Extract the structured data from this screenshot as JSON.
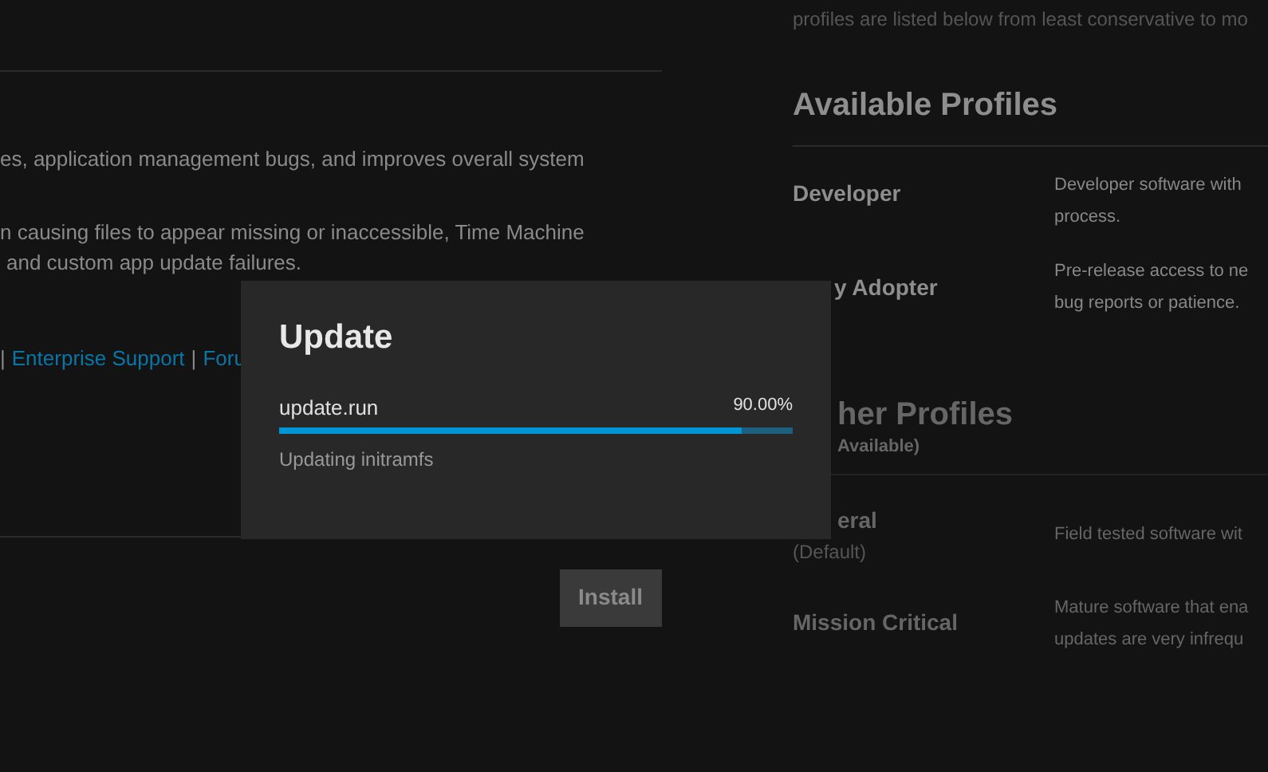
{
  "left": {
    "paragraphs": [
      "es, application management bugs, and improves overall system",
      "n causing files to appear missing or inaccessible, Time Machine",
      "and custom app update failures."
    ],
    "links": [
      {
        "kind": "sep",
        "text": "|"
      },
      {
        "kind": "link",
        "text": "Enterprise Support"
      },
      {
        "kind": "sep",
        "text": "|"
      },
      {
        "kind": "link",
        "text": "Foru"
      }
    ],
    "install_button": {
      "label": "Install",
      "disabled": true
    }
  },
  "right": {
    "intro": "profiles are listed below from least conservative to mo",
    "available": {
      "title": "Available Profiles",
      "profiles": [
        {
          "name": "Developer",
          "description": "Developer software with",
          "description_2": "process."
        },
        {
          "name": "y Adopter",
          "description": "Pre-release access to ne",
          "description_2": "bug reports or patience."
        }
      ]
    },
    "other": {
      "title": "her Profiles",
      "subtitle": "Available)",
      "profiles": [
        {
          "name": "eral",
          "note": "(Default)",
          "description": "Field tested software wit"
        },
        {
          "name": "Mission Critical",
          "description": "Mature software that ena",
          "description_2": "updates are very infrequ"
        }
      ]
    }
  },
  "dialog": {
    "title": "Update",
    "file": "update.run",
    "percent": "90.00%",
    "level": 0.9,
    "status": "Updating initramfs"
  }
}
